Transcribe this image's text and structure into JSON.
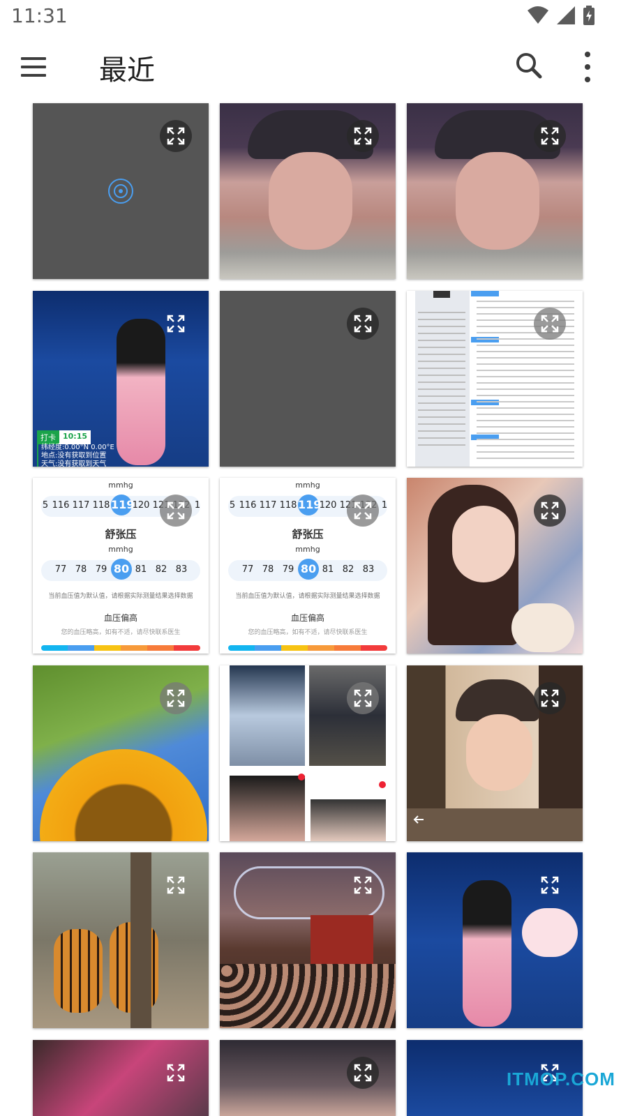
{
  "status": {
    "time": "11:31"
  },
  "app_bar": {
    "title": "最近"
  },
  "icons": {
    "menu": "menu-icon",
    "search": "search-icon",
    "more": "more-vert-icon",
    "expand": "fullscreen-icon"
  },
  "bp_card": {
    "unit_top": "mmhg",
    "systolic_values": [
      "5",
      "116",
      "117",
      "118",
      "119",
      "120",
      "121",
      "122",
      "1"
    ],
    "systolic_selected": "119",
    "title": "舒张压",
    "unit": "mmhg",
    "diastolic_values": [
      "77",
      "78",
      "79",
      "80",
      "81",
      "82",
      "83"
    ],
    "diastolic_selected": "80",
    "hint": "当前血压值为默认值，请根据实际测量结果选择数据",
    "result": "血压偏高",
    "advice": "您的血压略高，如有不适，请尽快联系医生"
  },
  "photo_overlay": {
    "checkin": "打卡",
    "clock": "10:15",
    "line1": "纬经度:0.00°N 0.00°E",
    "line2": "地点:没有获取到位置",
    "line3": "天气:没有获取到天气"
  },
  "watermark": "ITMOP.COM",
  "colors": {
    "accent": "#4a9ef0",
    "placeholder": "#555555",
    "bar": [
      "#13b5f0",
      "#4a9ef0",
      "#f7c313",
      "#f79a3a",
      "#f77b3a",
      "#f23b3b"
    ]
  }
}
